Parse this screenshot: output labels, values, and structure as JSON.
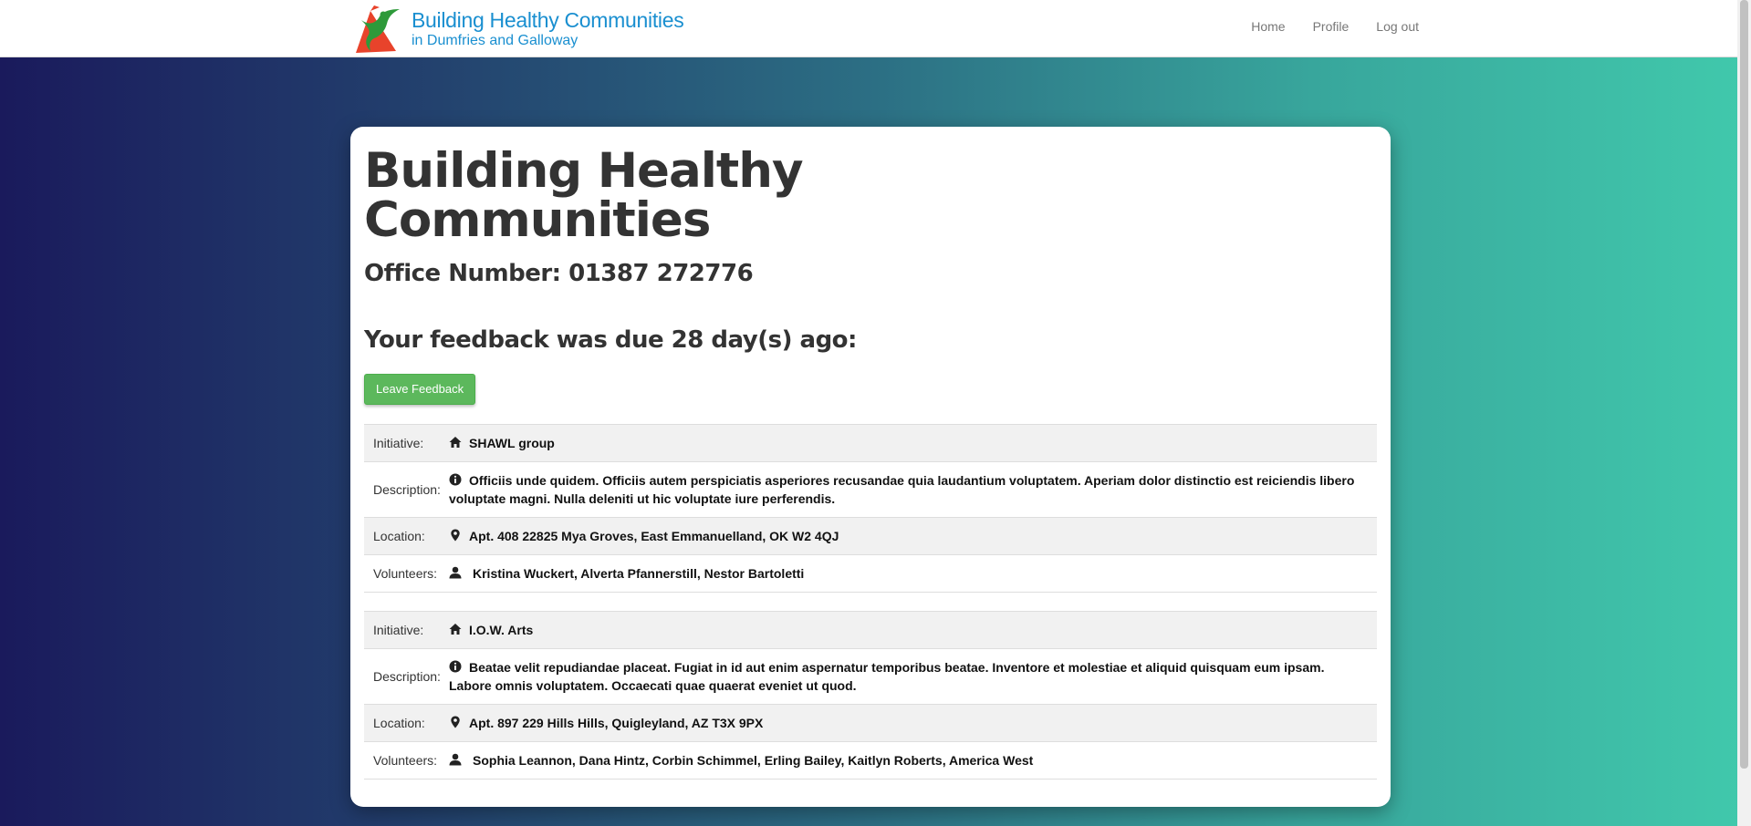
{
  "header": {
    "brand_title": "Building Healthy Communities",
    "brand_subtitle": "in Dumfries and Galloway",
    "nav": [
      {
        "label": "Home"
      },
      {
        "label": "Profile"
      },
      {
        "label": "Log out"
      }
    ]
  },
  "main": {
    "title_line1": "Building Healthy",
    "title_line2": "Communities",
    "office_number": "Office Number: 01387 272776",
    "feedback_due": "Your feedback was due 28 day(s) ago:",
    "leave_feedback_label": "Leave Feedback",
    "labels": {
      "initiative": "Initiative:",
      "description": "Description:",
      "location": "Location:",
      "volunteers": "Volunteers:"
    },
    "initiatives": [
      {
        "name": "SHAWL group",
        "description": "Officiis unde quidem. Officiis autem perspiciatis asperiores recusandae quia laudantium voluptatem. Aperiam dolor distinctio est reiciendis libero voluptate magni. Nulla deleniti ut hic voluptate iure perferendis.",
        "location": "Apt. 408 22825 Mya Groves, East Emmanuelland, OK W2 4QJ",
        "volunteers": "Kristina Wuckert, Alverta Pfannerstill, Nestor Bartoletti"
      },
      {
        "name": "I.O.W. Arts",
        "description": "Beatae velit repudiandae placeat. Fugiat in id aut enim aspernatur temporibus beatae. Inventore et molestiae et aliquid quisquam eum ipsam. Labore omnis voluptatem. Occaecati quae quaerat eveniet ut quod.",
        "location": "Apt. 897 229 Hills Hills, Quigleyland, AZ T3X 9PX",
        "volunteers": "Sophia Leannon, Dana Hintz, Corbin Schimmel, Erling Bailey, Kaitlyn Roberts, America West"
      }
    ]
  },
  "icons": {
    "initiative": "home-icon",
    "description": "info-sign-icon",
    "location": "map-marker-icon",
    "volunteers": "user-icon"
  },
  "colors": {
    "brand_blue": "#1a8fd0",
    "button_green": "#5cb85c",
    "logo_red": "#e8432b",
    "logo_green": "#2e9a3a"
  }
}
